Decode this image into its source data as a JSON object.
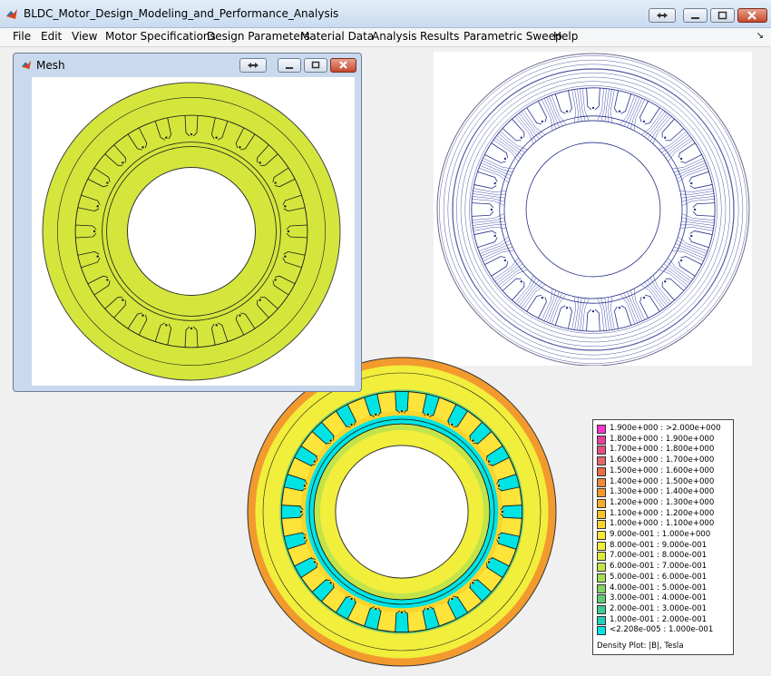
{
  "window": {
    "title": "BLDC_Motor_Design_Modeling_and_Performance_Analysis"
  },
  "menu": [
    "File",
    "Edit",
    "View",
    "Motor Specifications",
    "Design Parameters",
    "Material Data",
    "Analysis",
    "Results",
    "Parametric Sweep",
    "Help"
  ],
  "mesh_window": {
    "title": "Mesh"
  },
  "motor": {
    "stator_slots": 24
  },
  "legend": {
    "entries": [
      {
        "label": "1.900e+000 : >2.000e+000",
        "color": "#ff33cc"
      },
      {
        "label": "1.800e+000 : 1.900e+000",
        "color": "#e8409c"
      },
      {
        "label": "1.700e+000 : 1.800e+000",
        "color": "#e2507e"
      },
      {
        "label": "1.600e+000 : 1.700e+000",
        "color": "#e46666"
      },
      {
        "label": "1.500e+000 : 1.600e+000",
        "color": "#ea6c48"
      },
      {
        "label": "1.400e+000 : 1.500e+000",
        "color": "#ef8a3a"
      },
      {
        "label": "1.300e+000 : 1.400e+000",
        "color": "#f39a2e"
      },
      {
        "label": "1.200e+000 : 1.300e+000",
        "color": "#f7ae2a"
      },
      {
        "label": "1.100e+000 : 1.200e+000",
        "color": "#fac22a"
      },
      {
        "label": "1.000e+000 : 1.100e+000",
        "color": "#fcd42e"
      },
      {
        "label": "9.000e-001 : 1.000e+000",
        "color": "#fde43a"
      },
      {
        "label": "8.000e-001 : 9.000e-001",
        "color": "#f2ee3c"
      },
      {
        "label": "7.000e-001 : 8.000e-001",
        "color": "#dcea40"
      },
      {
        "label": "6.000e-001 : 7.000e-001",
        "color": "#c2e44a"
      },
      {
        "label": "5.000e-001 : 6.000e-001",
        "color": "#a4dc54"
      },
      {
        "label": "4.000e-001 : 5.000e-001",
        "color": "#84d460"
      },
      {
        "label": "3.000e-001 : 4.000e-001",
        "color": "#60cc78"
      },
      {
        "label": "2.000e-001 : 3.000e-001",
        "color": "#3ec894"
      },
      {
        "label": "1.000e-001 : 2.000e-001",
        "color": "#22d0b8"
      },
      {
        "label": "<2.208e-005 : 1.000e-001",
        "color": "#00e4e4"
      }
    ],
    "footer": "Density Plot: |B|, Tesla"
  }
}
